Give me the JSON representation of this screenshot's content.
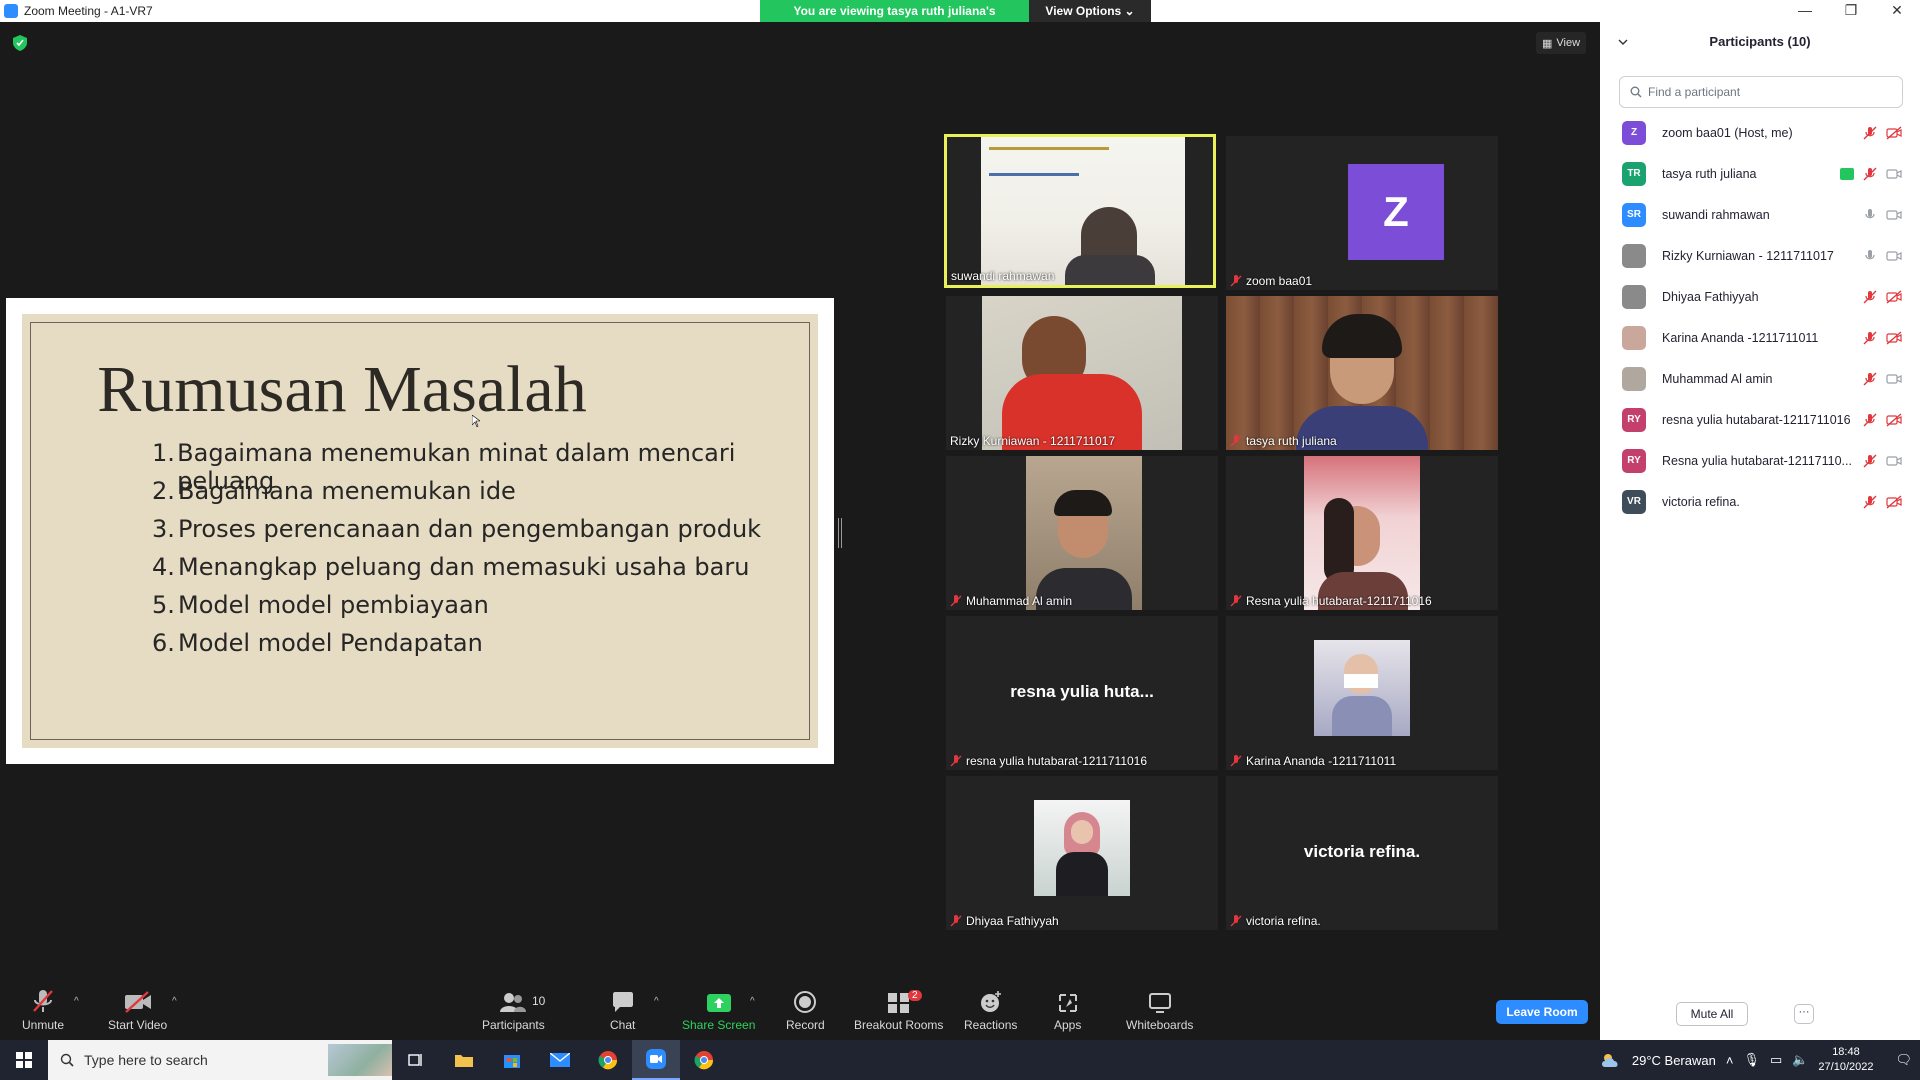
{
  "window": {
    "title": "Zoom Meeting - A1-VR7"
  },
  "banner": {
    "viewing": "You are viewing tasya ruth juliana's screen",
    "view_options": "View Options"
  },
  "view_label": "View",
  "slide": {
    "title": "Rumusan Masalah",
    "items": [
      {
        "num": "1.",
        "text": "Bagaimana menemukan minat dalam mencari peluang"
      },
      {
        "num": "2.",
        "text": "Bagaimana menemukan ide"
      },
      {
        "num": "3.",
        "text": "Proses perencanaan dan pengembangan produk"
      },
      {
        "num": "4.",
        "text": "Menangkap peluang dan memasuki usaha baru"
      },
      {
        "num": "5.",
        "text": "Model model pembiayaan"
      },
      {
        "num": "6.",
        "text": "Model model Pendapatan"
      }
    ]
  },
  "tiles": [
    {
      "name": "suwandi rahmawan",
      "muted": false,
      "active": true
    },
    {
      "name": "zoom baa01",
      "muted": true,
      "avatar": "Z"
    },
    {
      "name": "Rizky Kurniawan - 1211711017",
      "muted": false
    },
    {
      "name": "tasya ruth juliana",
      "muted": true
    },
    {
      "name": "Muhammad Al amin",
      "muted": true
    },
    {
      "name": "Resna yulia hutabarat-1211711016",
      "muted": true
    },
    {
      "name": "resna yulia hutabarat-1211711016",
      "muted": true,
      "big": "resna yulia huta..."
    },
    {
      "name": "Karina Ananda -1211711011",
      "muted": true
    },
    {
      "name": "Dhiyaa Fathiyyah",
      "muted": true
    },
    {
      "name": "victoria refina.",
      "muted": true,
      "big": "victoria refina."
    }
  ],
  "panel": {
    "title": "Participants (10)",
    "search_placeholder": "Find a participant",
    "participants": [
      {
        "initials": "Z",
        "color": "#7c4dd6",
        "name": "zoom baa01 (Host, me)",
        "mic": "off",
        "video": "off"
      },
      {
        "initials": "TR",
        "color": "#1aa36f",
        "name": "tasya ruth juliana",
        "mic": "off",
        "video": "on",
        "sharing": true
      },
      {
        "initials": "SR",
        "color": "#2d8cff",
        "name": "suwandi rahmawan",
        "mic": "on",
        "video": "on"
      },
      {
        "initials": "",
        "color": "#8a8a8a",
        "name": "Rizky Kurniawan - 1211711017",
        "mic": "on",
        "video": "on"
      },
      {
        "initials": "",
        "color": "#8a8a8a",
        "name": "Dhiyaa Fathiyyah",
        "mic": "off",
        "video": "off"
      },
      {
        "initials": "",
        "color": "#c9a79a",
        "name": "Karina Ananda -1211711011",
        "mic": "off",
        "video": "off"
      },
      {
        "initials": "",
        "color": "#b0a89e",
        "name": "Muhammad Al amin",
        "mic": "off",
        "video": "on"
      },
      {
        "initials": "RY",
        "color": "#c2406b",
        "name": "resna yulia hutabarat-1211711016",
        "mic": "off",
        "video": "off"
      },
      {
        "initials": "RY",
        "color": "#c2406b",
        "name": "Resna yulia hutabarat-12117110...",
        "mic": "off",
        "video": "on"
      },
      {
        "initials": "VR",
        "color": "#3f4c5a",
        "name": "victoria refina.",
        "mic": "off",
        "video": "off"
      }
    ],
    "mute_all": "Mute All",
    "more": "···"
  },
  "toolbar": {
    "unmute": "Unmute",
    "start_video": "Start Video",
    "participants": "Participants",
    "participants_count": "10",
    "chat": "Chat",
    "share_screen": "Share Screen",
    "record": "Record",
    "breakout_rooms": "Breakout Rooms",
    "breakout_badge": "2",
    "reactions": "Reactions",
    "apps": "Apps",
    "whiteboards": "Whiteboards",
    "leave": "Leave Room"
  },
  "taskbar": {
    "search_placeholder": "Type here to search",
    "weather": "29°C  Berawan",
    "time": "18:48",
    "date": "27/10/2022"
  }
}
